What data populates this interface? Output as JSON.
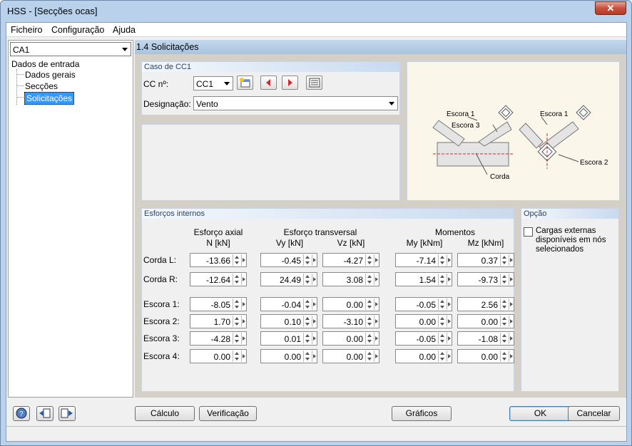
{
  "window": {
    "title": "HSS - [Secções ocas]",
    "close_glyph": "✕"
  },
  "menu": {
    "items": [
      "Ficheiro",
      "Configuração",
      "Ajuda"
    ]
  },
  "left": {
    "combo_value": "CA1",
    "tree": {
      "root": "Dados de entrada",
      "items": [
        "Dados gerais",
        "Secções",
        "Solicitações"
      ],
      "selected": "Solicitações"
    }
  },
  "section_title": "1.4 Solicitações",
  "case": {
    "panel_title": "Caso de CC1",
    "cc_label": "CC nº:",
    "cc_value": "CC1",
    "designation_label": "Designação:",
    "designation_value": "Vento"
  },
  "diagram": {
    "labels": {
      "escora1_a": "Escora 1",
      "escora3": "Escora 3",
      "corda": "Corda",
      "escora1_b": "Escora 1",
      "escora2": "Escora 2"
    }
  },
  "forces": {
    "panel_title": "Esforços internos",
    "groups": {
      "axial": "Esforço axial",
      "transversal": "Esforço transversal",
      "moments": "Momentos"
    },
    "columns": [
      "N  [kN]",
      "Vy  [kN]",
      "Vz  [kN]",
      "My  [kNm]",
      "Mz  [kNm]"
    ],
    "rows": [
      {
        "label": "Corda L:",
        "values": [
          "-13.66",
          "-0.45",
          "-4.27",
          "-7.14",
          "0.37"
        ]
      },
      {
        "label": "Corda R:",
        "values": [
          "-12.64",
          "24.49",
          "3.08",
          "1.54",
          "-9.73"
        ]
      },
      {
        "label": "Escora 1:",
        "values": [
          "-8.05",
          "-0.04",
          "0.00",
          "-0.05",
          "2.56"
        ]
      },
      {
        "label": "Escora 2:",
        "values": [
          "1.70",
          "0.10",
          "-3.10",
          "0.00",
          "0.00"
        ]
      },
      {
        "label": "Escora 3:",
        "values": [
          "-4.28",
          "0.01",
          "0.00",
          "-0.05",
          "-1.08"
        ]
      },
      {
        "label": "Escora 4:",
        "values": [
          "0.00",
          "0.00",
          "0.00",
          "0.00",
          "0.00"
        ]
      }
    ]
  },
  "option": {
    "panel_title": "Opção",
    "checkbox_label_1": "Cargas externas",
    "checkbox_label_2": "disponíveis em nós",
    "checkbox_label_3": "selecionados",
    "checked": false
  },
  "buttons": {
    "calc": "Cálculo",
    "verify": "Verificação",
    "graphics": "Gráficos",
    "ok": "OK",
    "cancel": "Cancelar"
  },
  "icons": {
    "help": "help-icon",
    "import": "import-icon",
    "export": "export-icon"
  }
}
